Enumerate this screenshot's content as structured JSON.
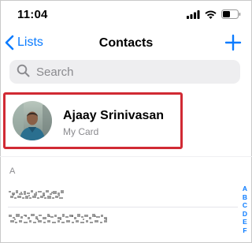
{
  "status_bar": {
    "time": "11:04",
    "icons": [
      "signal-icon",
      "wifi-icon",
      "battery-icon"
    ]
  },
  "nav": {
    "back_label": "Lists",
    "title": "Contacts",
    "add_icon": "plus-icon"
  },
  "search": {
    "placeholder": "Search",
    "icon": "search-icon"
  },
  "my_card": {
    "name": "Ajaay Srinivasan",
    "subtitle": "My Card"
  },
  "section": {
    "letter": "A"
  },
  "index_letters": [
    "A",
    "B",
    "C",
    "D",
    "E",
    "F"
  ],
  "colors": {
    "accent": "#0a7bff",
    "highlight_border": "#d12a34",
    "secondary_text": "#8a8a8e",
    "search_bg": "#eeeef0"
  }
}
